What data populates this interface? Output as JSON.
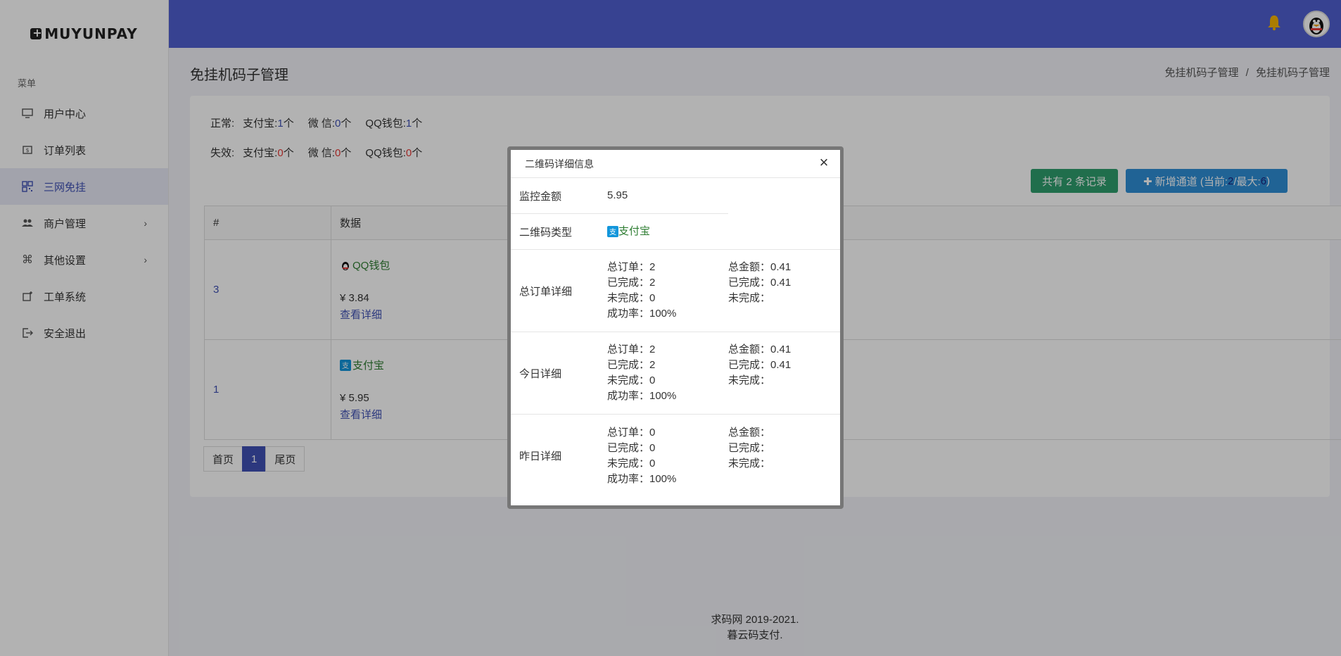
{
  "brand": "MUYUNPAY",
  "sidebar": {
    "menu_title": "菜单",
    "items": [
      {
        "label": "用户中心",
        "icon": "monitor-icon"
      },
      {
        "label": "订单列表",
        "icon": "receipt-icon"
      },
      {
        "label": "三网免挂",
        "icon": "qrcode-icon",
        "active": true
      },
      {
        "label": "商户管理",
        "icon": "users-icon",
        "has_children": true
      },
      {
        "label": "其他设置",
        "icon": "command-icon",
        "has_children": true
      },
      {
        "label": "工单系统",
        "icon": "ticket-icon"
      },
      {
        "label": "安全退出",
        "icon": "logout-icon"
      }
    ]
  },
  "header": {
    "bell_icon": "bell-icon",
    "avatar_icon": "qq-penguin-avatar",
    "accent": "#4f5fd0"
  },
  "page": {
    "title": "免挂机码子管理",
    "breadcrumb": [
      "免挂机码子管理",
      "免挂机码子管理"
    ],
    "breadcrumb_sep": "/"
  },
  "stats": {
    "normal_label": "正常:",
    "invalid_label": "失效:",
    "alipay_label": "支付宝:",
    "wechat_label": "微 信:",
    "qq_label": "QQ钱包:",
    "unit": "个",
    "normal": {
      "alipay": "1",
      "wechat": "0",
      "qq": "1"
    },
    "invalid": {
      "alipay": "0",
      "wechat": "0",
      "qq": "0"
    }
  },
  "actions": {
    "total_records": "共有 2 条记录",
    "add_channel_prefix": "✚ 新增通道 (当前:",
    "add_channel_current": "2",
    "add_channel_mid": "/最大:",
    "add_channel_max": "6",
    "add_channel_suffix": ")"
  },
  "table": {
    "headers": [
      "#",
      "数据"
    ],
    "rows": [
      {
        "id": "3",
        "channel": "QQ钱包",
        "channel_icon": "qq-icon",
        "amount": "¥ 3.84",
        "detail": "查看详细"
      },
      {
        "id": "1",
        "channel": "支付宝",
        "channel_icon": "alipay-icon",
        "amount": "¥ 5.95",
        "detail": "查看详细"
      }
    ]
  },
  "pager": {
    "first": "首页",
    "current": "1",
    "last": "尾页"
  },
  "footer": {
    "line1": "求码网 2019-2021.",
    "line2": "暮云码支付."
  },
  "modal": {
    "title": "二维码详细信息",
    "close": "×",
    "monitor_label": "监控金额",
    "monitor_value": "5.95",
    "type_label": "二维码类型",
    "type_value": "支付宝",
    "sections": [
      {
        "label": "总订单详细",
        "left": [
          "总订单：2",
          "已完成：2",
          "未完成：0",
          "成功率：100%"
        ],
        "right": [
          "总金额：0.41",
          "已完成：0.41",
          "未完成："
        ]
      },
      {
        "label": "今日详细",
        "left": [
          "总订单：2",
          "已完成：2",
          "未完成：0",
          "成功率：100%"
        ],
        "right": [
          "总金额：0.41",
          "已完成：0.41",
          "未完成："
        ]
      },
      {
        "label": "昨日详细",
        "left": [
          "总订单：0",
          "已完成：0",
          "未完成：0",
          "成功率：100%"
        ],
        "right": [
          "总金额：",
          "已完成：",
          "未完成："
        ]
      }
    ]
  }
}
